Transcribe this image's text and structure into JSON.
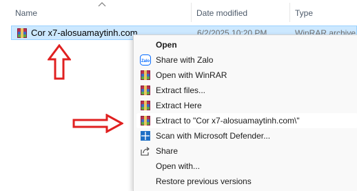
{
  "columns": {
    "name": "Name",
    "date_modified": "Date modified",
    "type": "Type"
  },
  "file": {
    "name": "Cor x7-alosuamaytinh.com",
    "date_modified": "6/2/2025 10:20 PM",
    "type": "WinRAR archive",
    "icon": "winrar-archive-icon"
  },
  "context_menu": {
    "items": [
      {
        "label": "Open",
        "icon": "none",
        "bold": true
      },
      {
        "label": "Share with Zalo",
        "icon": "zalo-icon"
      },
      {
        "label": "Open with WinRAR",
        "icon": "winrar-icon"
      },
      {
        "label": "Extract files...",
        "icon": "winrar-icon"
      },
      {
        "label": "Extract Here",
        "icon": "winrar-icon"
      },
      {
        "label": "Extract to \"Cor x7-alosuamaytinh.com\\\"",
        "icon": "winrar-icon"
      },
      {
        "label": "Scan with Microsoft Defender...",
        "icon": "defender-shield-icon"
      },
      {
        "label": "Share",
        "icon": "share-icon"
      },
      {
        "label": "Open with...",
        "icon": "none"
      },
      {
        "label": "Restore previous versions",
        "icon": "none"
      }
    ]
  },
  "colors": {
    "selection_bg": "#cce8ff",
    "annotation_arrow": "#e02020",
    "zalo_blue": "#0068ff",
    "defender_blue": "#1f6fc5"
  }
}
